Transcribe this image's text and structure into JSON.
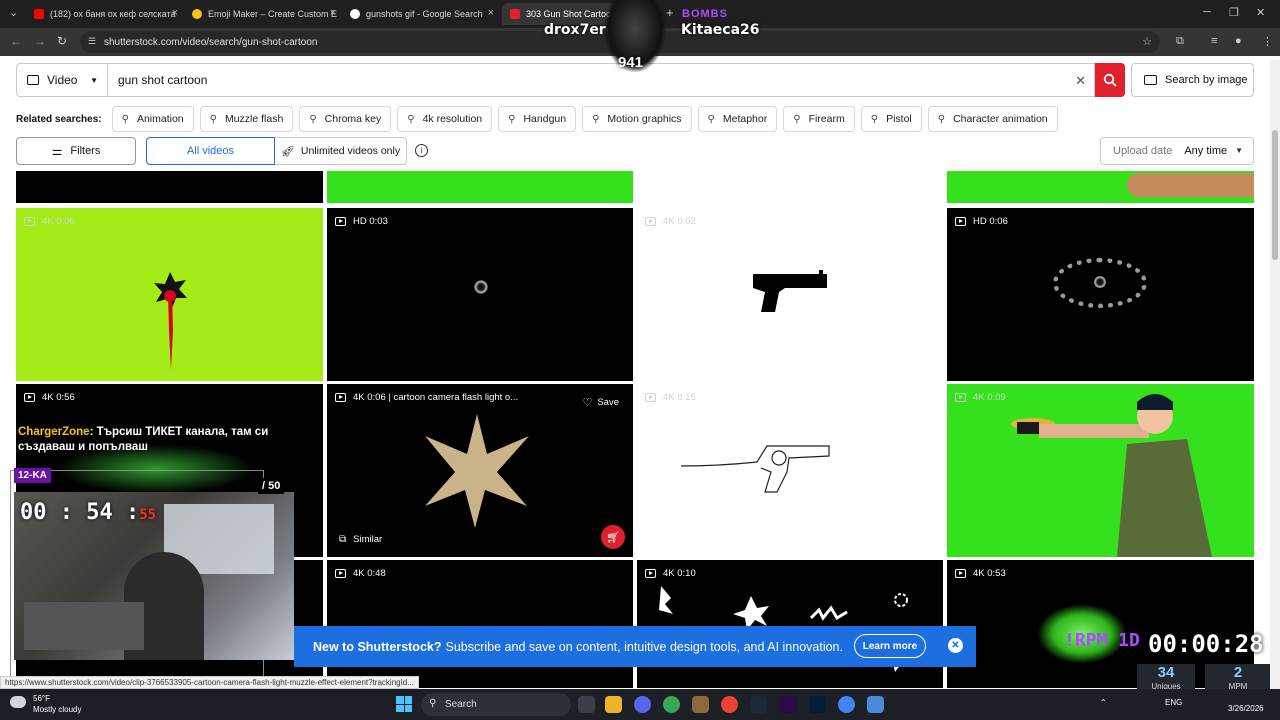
{
  "browser": {
    "tabs": [
      {
        "title": "(182) ох баня ох кеф селската",
        "favicon_color": "#ff0000"
      },
      {
        "title": "Emoji Maker – Create Custom E",
        "favicon_color": "#f5c518"
      },
      {
        "title": "gunshots gif - Google Search",
        "favicon_color": "#ffffff"
      },
      {
        "title": "303 Gun Shot Cartoon Stock V",
        "favicon_color": "#e0202c"
      }
    ],
    "new_tab": "+",
    "url": "shutterstock.com/video/search/gun-shot-cartoon"
  },
  "stream_overlay": {
    "left_name": "drox7er",
    "right_name": "Kitaeca26",
    "bombs_label": "BOMBS",
    "mascot_number": "941",
    "kanal_label": "12-KA",
    "count_label": "/ 50",
    "timer": {
      "hm": "00 : 54 :",
      "sec": "55"
    },
    "chat_user": "ChargerZone",
    "chat_text": ": Търсиш ТИКЕТ канала, там си създаваш и попълваш",
    "rpm_label": "!RPM 1D",
    "clock": "00:00:28",
    "uniques": {
      "num": "34",
      "label": "Uniques"
    },
    "mpm": {
      "num": "2",
      "label": "MPM"
    }
  },
  "header": {
    "media_type": "Video",
    "search_value": "gun shot cartoon",
    "search_by_image": "Search by image"
  },
  "related": {
    "label": "Related searches:",
    "chips": [
      "Animation",
      "Muzzle flash",
      "Chroma key",
      "4k resolution",
      "Handgun",
      "Motion graphics",
      "Metaphor",
      "Firearm",
      "Pistol",
      "Character animation"
    ]
  },
  "filters": {
    "filters_label": "Filters",
    "all_videos": "All videos",
    "unlimited": "Unlimited videos only",
    "upload_date_label": "Upload date",
    "upload_date_value": "Any time"
  },
  "results": [
    {
      "meta": "4K 0:06"
    },
    {
      "meta": "HD 0:03"
    },
    {
      "meta": "4K 0:02"
    },
    {
      "meta": "HD 0:06"
    },
    {
      "meta": "4K 0:56"
    },
    {
      "meta": "4K 0:06 | cartoon camera flash light o...",
      "save": "Save",
      "similar": "Similar"
    },
    {
      "meta": "4K 0:15"
    },
    {
      "meta": "4K 0:09"
    },
    {
      "meta": "4K 0:48"
    },
    {
      "meta": "4K 0:10"
    },
    {
      "meta": "4K 0:53"
    }
  ],
  "banner": {
    "bold": "New to Shutterstock?",
    "text": "Subscribe and save on content, intuitive design tools, and AI innovation.",
    "cta": "Learn more"
  },
  "status_url": "https://www.shutterstock.com/video/clip-3766533905-cartoon-camera-flash-light-muzzle-effect-element?trackingId...",
  "taskbar": {
    "temp": "56°F",
    "weather": "Mostly cloudy",
    "search": "Search",
    "lang": "ENG",
    "date": "3/26/2026"
  },
  "colors": {
    "brand_red": "#e0202c",
    "accent_blue": "#1d6fe0",
    "chroma_green": "#35e01c"
  }
}
